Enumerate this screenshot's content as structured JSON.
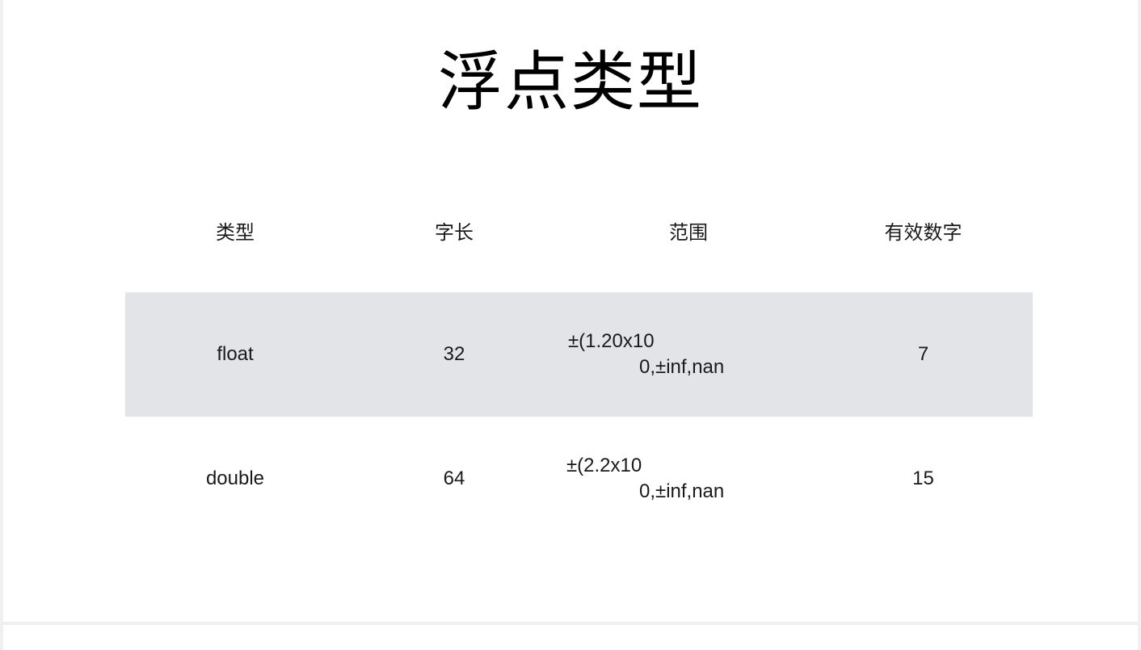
{
  "slide": {
    "title": "浮点类型"
  },
  "table": {
    "headers": [
      "类型",
      "字长",
      "范围",
      "有效数字"
    ],
    "rows": [
      {
        "type": "float",
        "bits": "32",
        "range_line1": "±(1.20x10",
        "range_line2": "0,±inf,nan",
        "digits": "7"
      },
      {
        "type": "double",
        "bits": "64",
        "range_line1": "±(2.2x10",
        "range_line2": "0,±inf,nan",
        "digits": "15"
      }
    ]
  },
  "colors": {
    "shaded_row": "#e3e4e8",
    "background": "#ffffff",
    "gutter": "#f0f0f2"
  }
}
